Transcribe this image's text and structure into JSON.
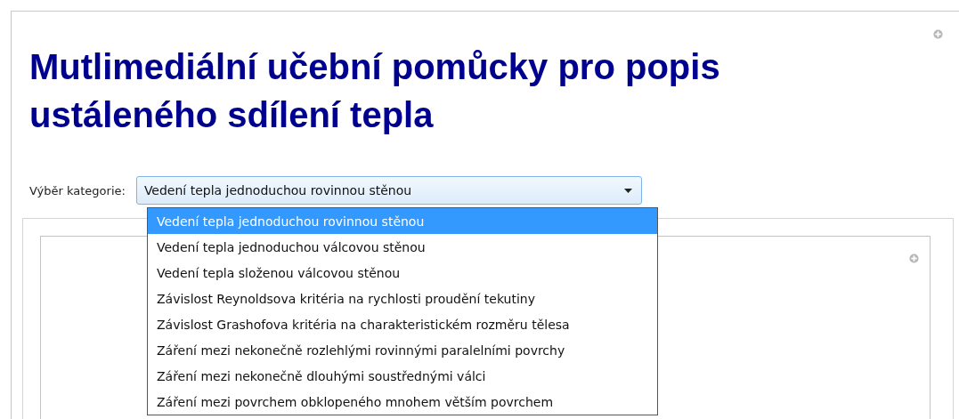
{
  "title": "Mutlimediální učební pomůcky pro popis ustáleného sdílení tepla",
  "category_select": {
    "label": "Výběr kategorie:",
    "value": "Vedení tepla jednoduchou rovinnou stěnou",
    "expanded": true,
    "options": [
      {
        "label": "Vedení tepla jednoduchou rovinnou stěnou",
        "selected": true
      },
      {
        "label": "Vedení tepla jednoduchou válcovou stěnou",
        "selected": false
      },
      {
        "label": "Vedení tepla složenou válcovou stěnou",
        "selected": false
      },
      {
        "label": "Závislost Reynoldsova kritéria na rychlosti proudění tekutiny",
        "selected": false
      },
      {
        "label": "Závislost Grashofova kritéria na charakteristickém rozměru tělesa",
        "selected": false
      },
      {
        "label": "Záření mezi nekonečně rozlehlými rovinnými paralelními povrchy",
        "selected": false
      },
      {
        "label": "Záření mezi nekonečně dlouhými soustřednými válci",
        "selected": false
      },
      {
        "label": "Záření mezi povrchem obklopeného mnohem větším povrchem",
        "selected": false
      }
    ]
  }
}
